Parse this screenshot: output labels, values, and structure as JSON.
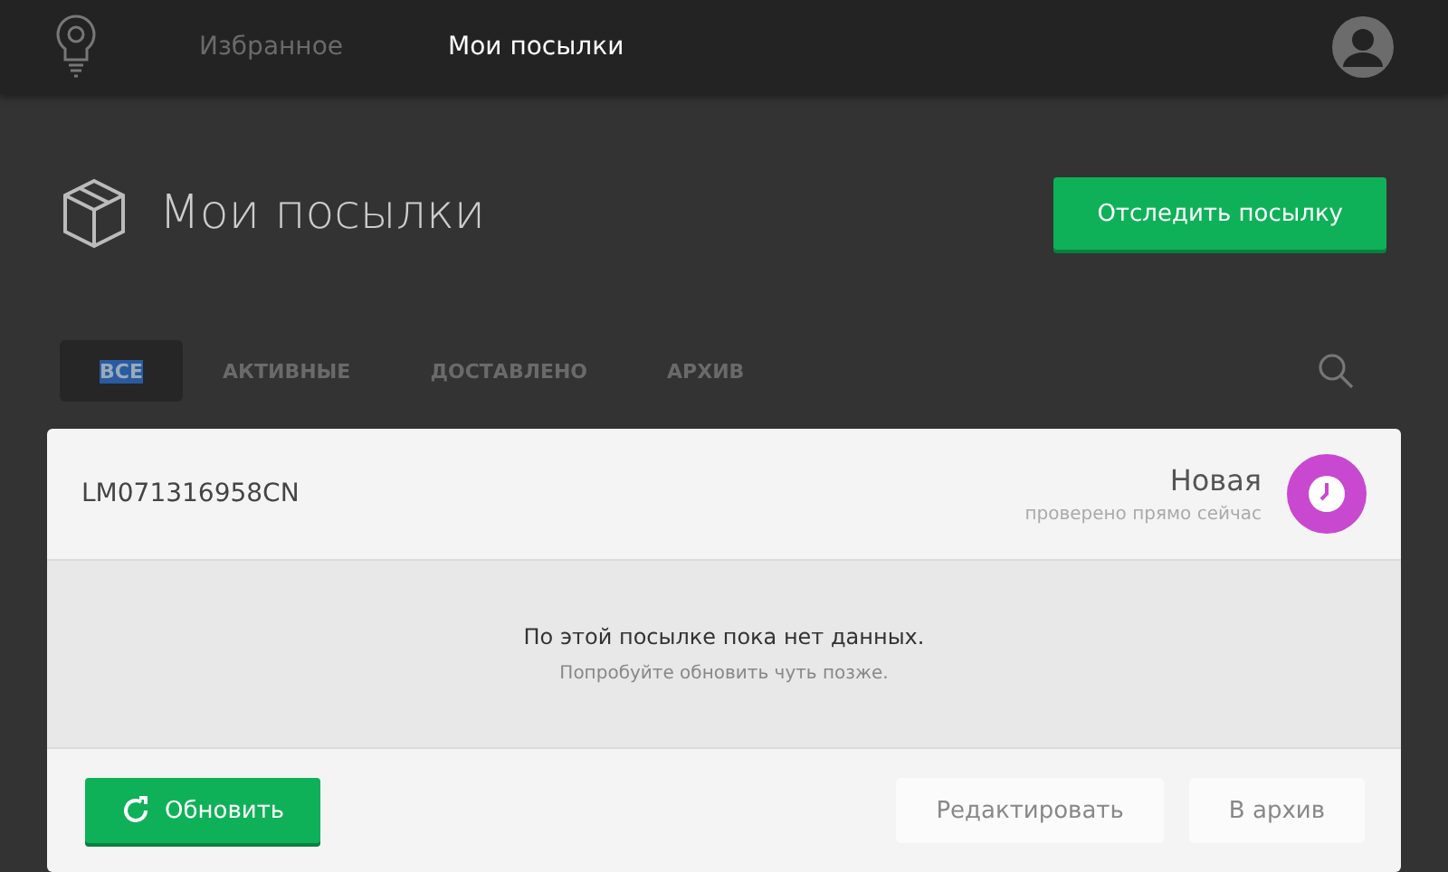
{
  "nav": {
    "items": [
      {
        "label": "Избранное",
        "selected": false
      },
      {
        "label": "Мои посылки",
        "selected": true
      }
    ]
  },
  "header": {
    "title": "Мои посылки",
    "track_button": "Отследить посылку"
  },
  "tabs": [
    {
      "label": "ВСЕ",
      "selected": true
    },
    {
      "label": "АКТИВНЫЕ",
      "selected": false
    },
    {
      "label": "ДОСТАВЛЕНО",
      "selected": false
    },
    {
      "label": "АРХИВ",
      "selected": false
    }
  ],
  "parcels": [
    {
      "tracking_number": "LM071316958CN",
      "status": "Новая",
      "checked": "проверено прямо сейчас",
      "color": "#c948d0",
      "empty_title": "По этой посылке пока нет данных.",
      "empty_hint": "Попробуйте обновить чуть позже.",
      "refresh_button": "Обновить",
      "edit_button": "Редактировать",
      "archive_button": "В архив"
    }
  ]
}
